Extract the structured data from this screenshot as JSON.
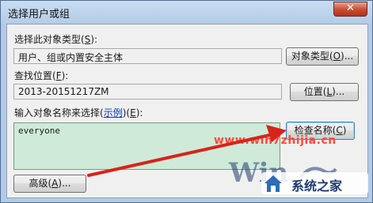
{
  "window": {
    "title": "选择用户或组",
    "close_glyph": "✕"
  },
  "object_type": {
    "label": "选择此对象类型",
    "accel": "S",
    "value": "用户、组或内置安全主体",
    "button_label": "对象类型",
    "button_accel": "O"
  },
  "location": {
    "label": "查找位置",
    "accel": "F",
    "value": "2013-20151217ZM",
    "button_label": "位置",
    "button_accel": "L"
  },
  "names": {
    "label_prefix": "输入对象名称来选择",
    "example_link": "示例",
    "accel": "E",
    "value": "everyone",
    "check_button_label": "检查名称",
    "check_button_accel": "C"
  },
  "advanced_button": {
    "label": "高级",
    "accel": "A"
  },
  "watermark": {
    "url": "www.win7zhijia.cn",
    "logo_text": "Win",
    "site_name": "系统之家"
  },
  "colors": {
    "arrow": "#d8231a",
    "watermark": "#ff4a3d",
    "name_box": "#cfead8"
  }
}
